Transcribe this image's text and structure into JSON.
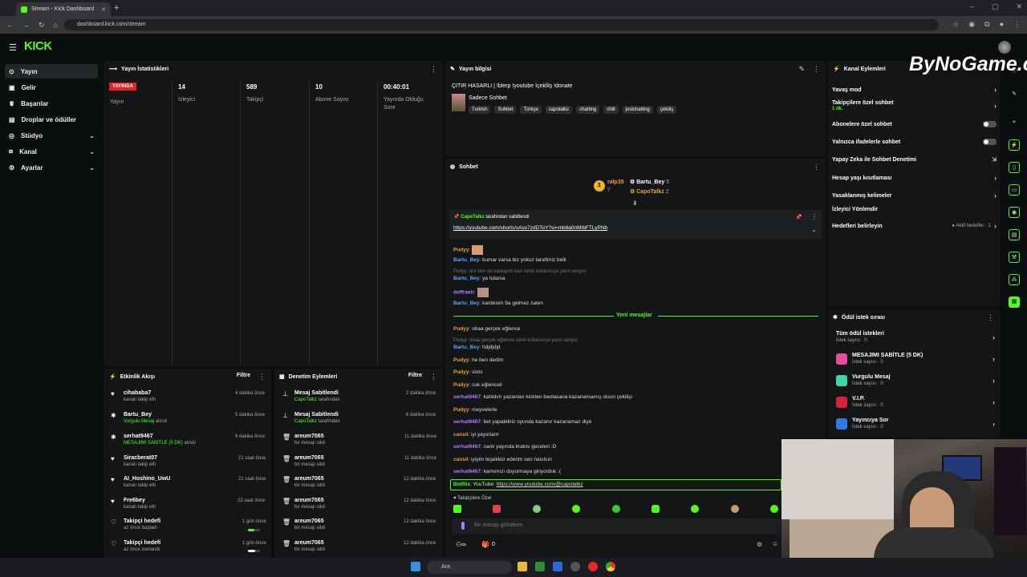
{
  "browser": {
    "tab_title": "Stream - Kick Dashboard",
    "url": "dashboard.kick.com/stream"
  },
  "app": {
    "logo": "KICK"
  },
  "sidebar": {
    "items": [
      {
        "label": "Yayın",
        "icon": "stream-icon"
      },
      {
        "label": "Gelir",
        "icon": "income-icon"
      },
      {
        "label": "Başarılar",
        "icon": "trophy-icon"
      },
      {
        "label": "Droplar ve ödüller",
        "icon": "gift-icon"
      },
      {
        "label": "Stüdyo",
        "icon": "studio-icon"
      },
      {
        "label": "Kanal",
        "icon": "channel-icon"
      },
      {
        "label": "Ayarlar",
        "icon": "gear-icon"
      }
    ]
  },
  "stats": {
    "title": "Yayın İstatistikleri",
    "live_badge": "YAYINDA",
    "live_label": "Yayın",
    "viewers": "14",
    "viewers_label": "İzleyici",
    "followers": "589",
    "followers_label": "Takipçi",
    "subs": "10",
    "subs_label": "Abone Sayısı",
    "duration": "00:40:01",
    "duration_label": "Yayında Olduğu Süre"
  },
  "stream_info": {
    "title": "Yayın bilgisi",
    "stream_title": "ÇITIR HASARLI | !blerp !youtube İçeklilş !donate",
    "category": "Sadece Sohbet",
    "tags": [
      "Turkish",
      "Sohbet",
      "Türkçe",
      "capotalkz",
      "chatting",
      "chill",
      "justchatting",
      "çekiliş"
    ]
  },
  "chat": {
    "title": "Sohbet",
    "top_gifters": [
      {
        "name": "ralp35",
        "count": "7"
      },
      {
        "name": "Bartu_Bey",
        "count": "5"
      },
      {
        "name": "CapoTalkz",
        "count": "2"
      }
    ],
    "pinned_by": "CapoTalkz",
    "pinned_suffix": "tarafından sabitlendi",
    "pinned_link": "https://youtube.com/shorts/vAsv7zdDToY?si=mb9a0nMIbFTLyPNb",
    "new_messages": "Yeni mesajlar",
    "followers_only": "Takipçilere Özel",
    "input_placeholder": "Bir mesajı gönderin",
    "count": "0"
  },
  "messages": [
    {
      "user": "Pudyy",
      "text": ""
    },
    {
      "user": "Bartu_Bey",
      "text": ": kumar varsa biz yokuz tarafimiz belli"
    },
    {
      "reply": "Pudyy: dur ben de katılayım bari isimli kullanıcıya yanıt veriyor"
    },
    {
      "user": "Bartu_Bey",
      "text": ": ya tutarsa"
    },
    {
      "user": "deffraeir",
      "text": ""
    },
    {
      "user": "Bartu_Bey",
      "text": ": kardesim 9a gelmez zaten"
    },
    {
      "user": "Pudyy",
      "text": ": obaa gerçek eğlence"
    },
    {
      "reply": "Pudyy: obaa gerçek eğlence isimli kullanıcıya yanıt veriyor"
    },
    {
      "user": "Bartu_Bey",
      "text": ": hdjdjdjd"
    },
    {
      "user": "Pudyy",
      "text": ": he ben dedim"
    },
    {
      "user": "Pudyy",
      "text": ": slots"
    },
    {
      "user": "Pudyy",
      "text": ": cok eğlenceli"
    },
    {
      "user": "serhat9467",
      "text": ": katıldım yazanları kickten banlasana kazanamamış olsun çekilişi"
    },
    {
      "user": "Pudyy",
      "text": ": meyvelerle"
    },
    {
      "user": "serhat9467",
      "text": ": bet yapabiliriz oyunda kazanır kazanamaz diye"
    },
    {
      "user": "cansii",
      "text": ": iyi yayınlarrr"
    },
    {
      "user": "serhat9467",
      "text": ": canlı yayında kratos geceleri :D"
    },
    {
      "user": "cansii",
      "text": ": iyiyim teşekkür ederim sen nasılsın"
    },
    {
      "user": "serhat9467",
      "text": ": karnımızı doyurmaya giriyorduk :("
    },
    {
      "user": "BotRix",
      "text": ": YouTube: ",
      "link": "https://www.youtube.com/@capotalkz"
    }
  ],
  "activity": {
    "title": "Etkinlik Akışı",
    "filter": "Filtre",
    "items": [
      {
        "name": "cihababa7",
        "sub": "kanalı takip etti",
        "time": "4 dakika önce",
        "icon": "heart-icon"
      },
      {
        "name": "Bartu_Bey",
        "sub_highlight": "Vurgulu Mesaj",
        "sub": " alındı",
        "time": "5 dakika önce",
        "icon": "reward-icon"
      },
      {
        "name": "serhat9467",
        "sub_highlight": "MESAJIMI SABİTLE (5 DK)",
        "sub": " alındı",
        "time": "6 dakika önce",
        "icon": "reward-icon"
      },
      {
        "name": "Siracberat07",
        "sub": "kanalı takip etti",
        "time": "21 saat önce",
        "icon": "heart-icon"
      },
      {
        "name": "AI_Hoshino_UwU",
        "sub": "kanalı takip etti",
        "time": "21 saat önce",
        "icon": "heart-icon"
      },
      {
        "name": "Fre6bey",
        "sub": "kanalı takip etti",
        "time": "22 saat önce",
        "icon": "heart-icon"
      },
      {
        "name": "Takipçi hedefi",
        "sub": "az önce başladı",
        "time": "1 gün önce",
        "icon": "heart-outline-icon",
        "progress": 0.5
      },
      {
        "name": "Takipçi hedefi",
        "sub": "az önce sonlandı",
        "time": "1 gün önce",
        "icon": "heart-outline-icon",
        "progress": 0.6
      }
    ]
  },
  "moderation": {
    "title": "Denetim Eylemleri",
    "filter": "Filtre",
    "items": [
      {
        "name": "Mesaj Sabitlendi",
        "sub_highlight": "CapoTalkz",
        "sub": " tarafından",
        "time": "2 dakika önce",
        "icon": "pin-icon"
      },
      {
        "name": "Mesaj Sabitlendi",
        "sub_highlight": "CapoTalkz",
        "sub": " tarafından",
        "time": "6 dakika önce",
        "icon": "pin-icon"
      },
      {
        "name": "areum7065",
        "sub": "bir mesajı sildi",
        "time": "11 dakika önce",
        "icon": "trash-icon"
      },
      {
        "name": "areum7065",
        "sub": "bir mesajı sildi",
        "time": "11 dakika önce",
        "icon": "trash-icon"
      },
      {
        "name": "areum7065",
        "sub": "bir mesajı sildi",
        "time": "12 dakika önce",
        "icon": "trash-icon"
      },
      {
        "name": "areum7065",
        "sub": "bir mesajı sildi",
        "time": "12 dakika önce",
        "icon": "trash-icon"
      },
      {
        "name": "areum7065",
        "sub": "bir mesajı sildi",
        "time": "12 dakika önce",
        "icon": "trash-icon"
      },
      {
        "name": "areum7065",
        "sub": "bir mesajı sildi",
        "time": "12 dakika önce",
        "icon": "trash-icon"
      }
    ]
  },
  "channel_actions": {
    "title": "Kanal Eylemleri",
    "items": [
      {
        "label": "Yavaş mod",
        "control": "arrow"
      },
      {
        "label": "Takipçilere özel sohbet",
        "sub": "1 dk.",
        "control": "arrow"
      },
      {
        "label": "Abonelere özel sohbet",
        "control": "toggle"
      },
      {
        "label": "Yalnızca ifadelerle sohbet",
        "control": "toggle"
      },
      {
        "label": "Yapay Zeka ile Sohbet Denetimi",
        "control": "external"
      },
      {
        "label": "Hesap yaşı kısıtlaması",
        "control": "arrow"
      },
      {
        "label": "Yasaklanmış kelimeler",
        "control": "arrow"
      },
      {
        "label": "İzleyici Yönlendir",
        "control": "none"
      },
      {
        "label": "Hedefleri belirleyin",
        "right": "Aktif hedefler · 1",
        "control": "arrow"
      }
    ]
  },
  "rewards": {
    "title": "Ödül istek sırası",
    "items": [
      {
        "label": "Tüm ödül istekleri",
        "sub": "İstek sayısı · 0",
        "color": ""
      },
      {
        "label": "MESAJIMI SABİTLE (5 DK)",
        "sub": "İstek sayısı · 0",
        "color": "#e84a9a"
      },
      {
        "label": "Vurgulu Mesaj",
        "sub": "İstek sayısı · 0",
        "color": "#3ed6a8"
      },
      {
        "label": "V.I.P.",
        "sub": "İstek sayısı · 0",
        "color": "#d8213a"
      },
      {
        "label": "Yayıncıya Sor",
        "sub": "İstek sayısı · 0",
        "color": "#2a7de1"
      }
    ]
  },
  "watermark": "ByNoGame.com",
  "taskbar": {
    "search": "Ara"
  }
}
